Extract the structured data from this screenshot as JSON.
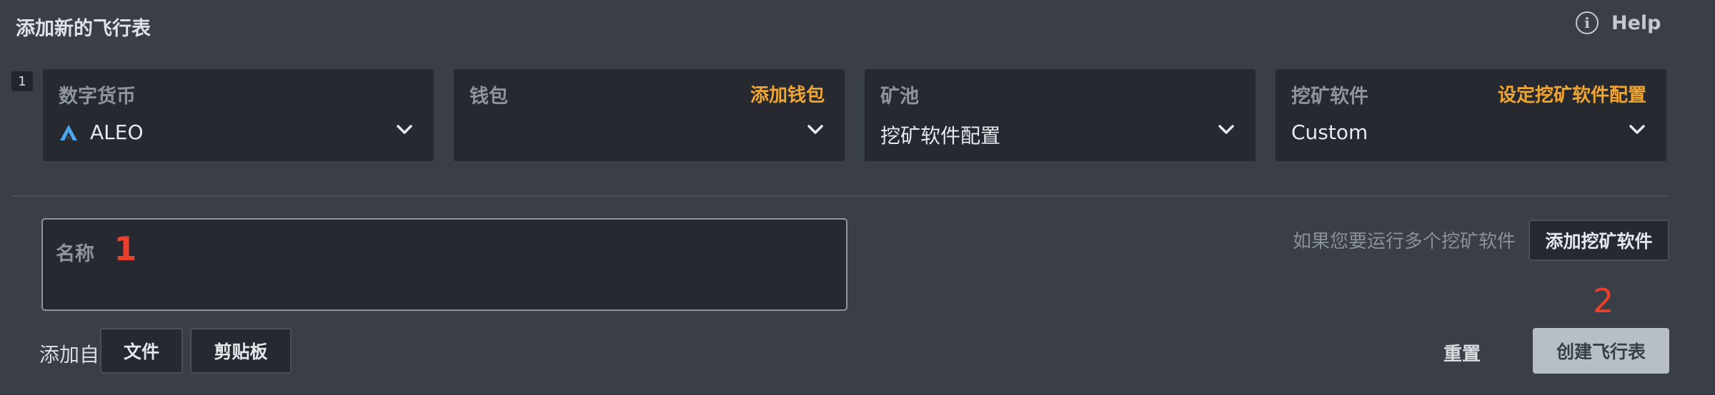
{
  "header": {
    "title": "添加新的飞行表",
    "help_label": "Help",
    "help_icon": "info-icon"
  },
  "row": {
    "number": "1"
  },
  "fields": [
    {
      "label": "数字货币",
      "value": "ALEO",
      "icon": "aleo-logo-icon",
      "action": ""
    },
    {
      "label": "钱包",
      "value": "",
      "action": "添加钱包"
    },
    {
      "label": "矿池",
      "value": "挖矿软件配置",
      "action": ""
    },
    {
      "label": "挖矿软件",
      "value": "Custom",
      "action": "设定挖矿软件配置"
    }
  ],
  "name_field": {
    "label": "名称",
    "value": ""
  },
  "annotations": {
    "marker1": "1",
    "marker2": "2"
  },
  "miner": {
    "hint": "如果您要运行多个挖矿软件",
    "add_button": "添加挖矿软件"
  },
  "footer": {
    "add_from_label": "添加自",
    "file_button": "文件",
    "clipboard_button": "剪贴板",
    "reset_button": "重置",
    "create_button": "创建飞行表"
  },
  "colors": {
    "accent": "#f0a531",
    "annotation": "#e8402c",
    "background": "#393e47",
    "card": "#26292f",
    "aleo_logo": "#4aa8f0"
  }
}
